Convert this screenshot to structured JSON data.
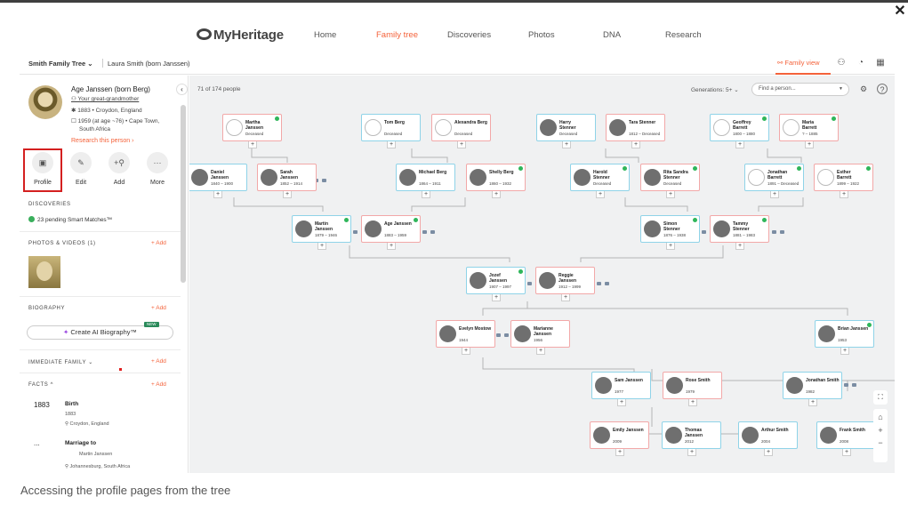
{
  "caption": "Accessing the profile pages from the tree",
  "nav": {
    "logo": "MyHeritage",
    "links": [
      "Home",
      "Family tree",
      "Discoveries",
      "Photos",
      "DNA",
      "Research"
    ],
    "active_index": 1
  },
  "subbar": {
    "tree_name": "Smith Family Tree ⌄",
    "person": "Laura Smith (born Janssen)",
    "family_view": "Family view"
  },
  "profile": {
    "name": "Age Janssen (born Berg)",
    "relation": "Your great-grandmother",
    "birth": "1883 • Croydon, England",
    "death_1": "1959 (at age ~76) • Cape Town,",
    "death_2": "South Africa",
    "research": "Research this person ›",
    "actions": [
      "Profile",
      "Edit",
      "Add",
      "More"
    ]
  },
  "sections": {
    "discoveries": "DISCOVERIES",
    "smart_matches": "23 pending Smart Matches™",
    "photos": "PHOTOS & VIDEOS (1)",
    "add": "+ Add",
    "biography": "BIOGRAPHY",
    "ai_bio": "Create AI Biography™",
    "new_badge": "NEW",
    "immediate_family": "IMMEDIATE FAMILY ⌄",
    "facts": "FACTS ^"
  },
  "facts": [
    {
      "year": "1883",
      "title": "Birth",
      "line1": "1883",
      "line2": "⚲ Croydon, England"
    },
    {
      "year": "...",
      "title": "Marriage to",
      "line1": "Martin Janssen",
      "line2": "⚲ Johannesburg, South Africa"
    }
  ],
  "tree_header": {
    "count": "71 of 174 people",
    "generations": "Generations: 5+ ⌄",
    "find_placeholder": "Find a person..."
  },
  "cards": [
    {
      "name": "Martha\nJanssen",
      "dates": "Deceased",
      "sex": "f",
      "photo": false,
      "dna": true
    },
    {
      "name": "Tom Berg",
      "dates": "Deceased",
      "sex": "m",
      "photo": false,
      "dna": false
    },
    {
      "name": "Alexandra Berg",
      "dates": "Deceased",
      "sex": "f",
      "photo": false,
      "dna": false
    },
    {
      "name": "Harry\nStenner",
      "dates": "Deceased",
      "sex": "m",
      "photo": true,
      "dna": false
    },
    {
      "name": "Tara Stenner",
      "dates": "1812 – Deceased",
      "sex": "f",
      "photo": true,
      "dna": false
    },
    {
      "name": "Geoffrey\nBarrett",
      "dates": "1800 – 1880",
      "sex": "m",
      "photo": false,
      "dna": true
    },
    {
      "name": "Maria\nBarrett",
      "dates": "? – 1885",
      "sex": "f",
      "photo": false,
      "dna": true
    },
    {
      "name": "Daniel\nJanssen",
      "dates": "1840 – 1900",
      "sex": "m",
      "photo": true,
      "dna": false
    },
    {
      "name": "Sarah\nJanssen",
      "dates": "1852 – 1914",
      "sex": "f",
      "photo": true,
      "dna": false
    },
    {
      "name": "Michael Berg",
      "dates": "1864 – 1911",
      "sex": "m",
      "photo": true,
      "dna": false
    },
    {
      "name": "Shelly Berg",
      "dates": "1860 – 1932",
      "sex": "f",
      "photo": true,
      "dna": true
    },
    {
      "name": "Harold\nStenner",
      "dates": "Deceased",
      "sex": "m",
      "photo": true,
      "dna": true
    },
    {
      "name": "Rita Sandra\nStenner",
      "dates": "Deceased",
      "sex": "f",
      "photo": true,
      "dna": true
    },
    {
      "name": "Jonathan\nBarrett",
      "dates": "1891 – Deceased",
      "sex": "m",
      "photo": false,
      "dna": true
    },
    {
      "name": "Esther\nBarrett",
      "dates": "1899 – 1922",
      "sex": "f",
      "photo": false,
      "dna": true
    },
    {
      "name": "Martin\nJanssen",
      "dates": "1879 – 1946",
      "sex": "m",
      "photo": true,
      "dna": true
    },
    {
      "name": "Age Janssen",
      "dates": "1883 – 1959",
      "sex": "f",
      "photo": true,
      "dna": true
    },
    {
      "name": "Simon\nStenner",
      "dates": "1876 – 1938",
      "sex": "m",
      "photo": true,
      "dna": true
    },
    {
      "name": "Tammy\nStenner",
      "dates": "1881 – 1983",
      "sex": "f",
      "photo": true,
      "dna": true
    },
    {
      "name": "Jozef\nJanssen",
      "dates": "1907 – 1997",
      "sex": "m",
      "photo": true,
      "dna": true
    },
    {
      "name": "Reggie\nJanssen",
      "dates": "1912 – 1999",
      "sex": "f",
      "photo": true,
      "dna": false
    },
    {
      "name": "Evelyn Mostow",
      "dates": "1944",
      "sex": "f",
      "photo": true,
      "dna": false
    },
    {
      "name": "Marianne\nJanssen",
      "dates": "1956",
      "sex": "f",
      "photo": true,
      "dna": false
    },
    {
      "name": "Brian Janssen",
      "dates": "1953",
      "sex": "m",
      "photo": true,
      "dna": true
    },
    {
      "name": "Sam Janssen",
      "dates": "1977",
      "sex": "m",
      "photo": true,
      "dna": false
    },
    {
      "name": "Rose Smith",
      "dates": "1979",
      "sex": "f",
      "photo": true,
      "dna": false
    },
    {
      "name": "Jonathan Smith",
      "dates": "1982",
      "sex": "m",
      "photo": true,
      "dna": false
    },
    {
      "name": "Emily Janssen",
      "dates": "2009",
      "sex": "f",
      "photo": true,
      "dna": false
    },
    {
      "name": "Thomas\nJanssen",
      "dates": "2012",
      "sex": "m",
      "photo": true,
      "dna": false
    },
    {
      "name": "Arthur Smith",
      "dates": "2004",
      "sex": "m",
      "photo": true,
      "dna": false
    },
    {
      "name": "Frank Smith",
      "dates": "2008",
      "sex": "m",
      "photo": true,
      "dna": false
    }
  ],
  "colors": {
    "accent": "#f4623a",
    "male": "#8fd3e8",
    "female": "#f2a8a8",
    "dna": "#2fb65a",
    "highlight": "#d42020"
  }
}
